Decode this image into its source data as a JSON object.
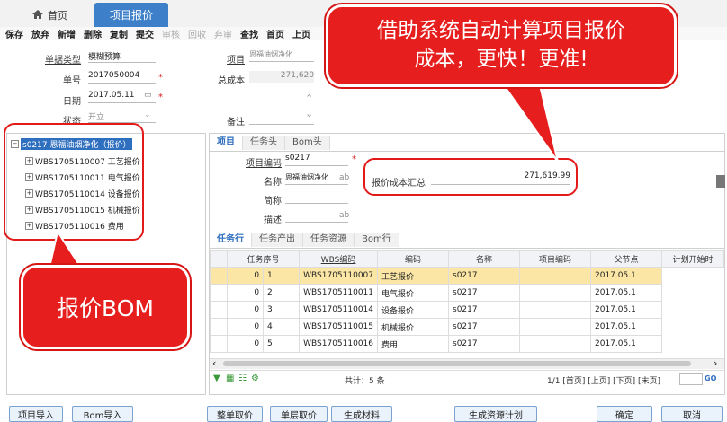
{
  "tabs": {
    "home": "首页",
    "active": "项目报价"
  },
  "toolbar": {
    "items": [
      "保存",
      "放弃",
      "新增",
      "删除",
      "复制",
      "提交",
      "审核",
      "回收",
      "弃审",
      "查找",
      "首页",
      "上页"
    ],
    "disabled": [
      "审核",
      "回收",
      "弃审"
    ]
  },
  "form": {
    "doc_type_label": "单据类型",
    "doc_type_value": "模糊预算",
    "doc_no_label": "单号",
    "doc_no_value": "2017050004",
    "date_label": "日期",
    "date_value": "2017.05.11",
    "status_label": "状态",
    "status_value": "开立",
    "project_label": "项目",
    "project_value": "恩福油烟净化",
    "total_cost_label": "总成本",
    "total_cost_value": "271,620",
    "remark_label": "备注"
  },
  "tree": {
    "root": "s0217 恩福油烟净化（报价）",
    "children": [
      "WBS1705110007 工艺报价",
      "WBS1705110011 电气报价",
      "WBS1705110014 设备报价",
      "WBS1705110015 机械报价",
      "WBS1705110016 费用"
    ]
  },
  "detail": {
    "tabs": [
      "项目",
      "任务头",
      "Bom头"
    ],
    "project_code_label": "项目编码",
    "project_code_value": "s0217",
    "name_label": "名称",
    "name_value": "恩福油烟净化",
    "name_suffix": "ab",
    "short_label": "简称",
    "desc_label": "描述",
    "desc_suffix": "ab",
    "summary_label": "报价成本汇总",
    "summary_value": "271,619.99"
  },
  "grid": {
    "tabs": [
      "任务行",
      "任务产出",
      "任务资源",
      "Bom行"
    ],
    "columns": [
      "任务序号",
      "WBS编码",
      "编码",
      "名称",
      "项目编码",
      "父节点",
      "计划开始时"
    ],
    "rows": [
      {
        "seq": "1",
        "wbs": "WBS1705110007",
        "name": "工艺报价",
        "proj": "s0217",
        "start": "2017.05.1"
      },
      {
        "seq": "2",
        "wbs": "WBS1705110011",
        "name": "电气报价",
        "proj": "s0217",
        "start": "2017.05.1"
      },
      {
        "seq": "3",
        "wbs": "WBS1705110014",
        "name": "设备报价",
        "proj": "s0217",
        "start": "2017.05.1"
      },
      {
        "seq": "4",
        "wbs": "WBS1705110015",
        "name": "机械报价",
        "proj": "s0217",
        "start": "2017.05.1"
      },
      {
        "seq": "5",
        "wbs": "WBS1705110016",
        "name": "费用",
        "proj": "s0217",
        "start": "2017.05.1"
      }
    ],
    "zero": "0",
    "total": "共计：5 条",
    "pager": "1/1 [首页] [上页] [下页] [末页]",
    "go": "GO"
  },
  "bottom_buttons": [
    "项目导入",
    "Bom导入",
    "整单取价",
    "单层取价",
    "生成材料",
    "生成资源计划",
    "确定",
    "取消"
  ],
  "callouts": {
    "big_line1": "借助系统自动计算项目报价",
    "big_line2": "成本，更快！更准!",
    "bom": "报价BOM"
  },
  "colors": {
    "accent": "#3d7fc8",
    "callout": "#e61e1e",
    "highlight_row": "#fbe6a5"
  }
}
